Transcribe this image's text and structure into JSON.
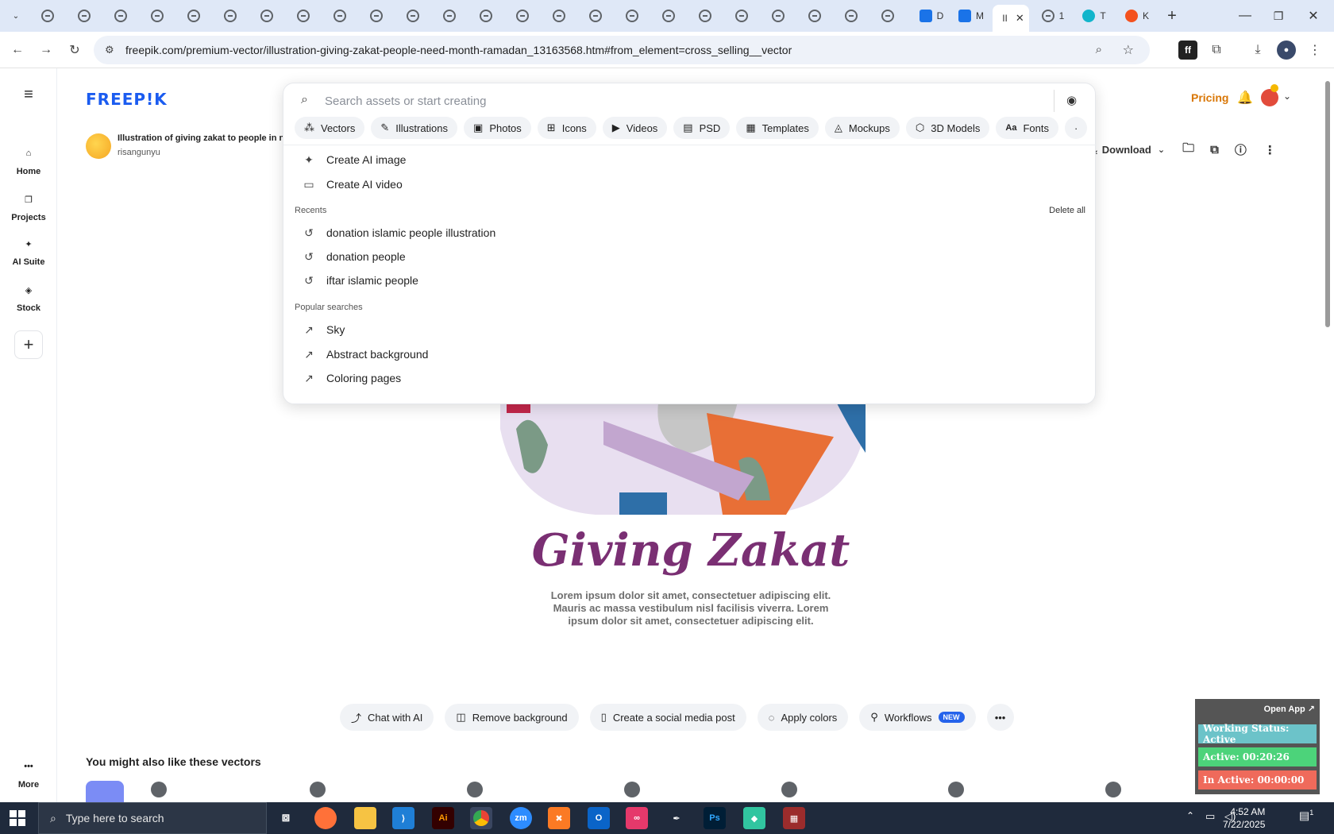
{
  "browser": {
    "tabs": [
      {
        "label": "D",
        "color": "#1a73e8"
      },
      {
        "label": "M",
        "color": "#1a73e8"
      },
      {
        "label": "II",
        "active": true
      },
      {
        "label": "1"
      },
      {
        "label": "T",
        "color": "#12b5cb"
      },
      {
        "label": "K",
        "color": "#f4511e"
      }
    ],
    "url": "freepik.com/premium-vector/illustration-giving-zakat-people-need-month-ramadan_13163568.htm#from_element=cross_selling__vector"
  },
  "rail": {
    "items": [
      {
        "label": "Home",
        "icon": "home-icon"
      },
      {
        "label": "Projects",
        "icon": "projects-icon"
      },
      {
        "label": "AI Suite",
        "icon": "sparkle-icon"
      },
      {
        "label": "Stock",
        "icon": "stock-icon"
      }
    ],
    "more": "More"
  },
  "header": {
    "logo": "FREEP!K",
    "pricing": "Pricing"
  },
  "asset": {
    "title": "Illustration of giving zakat to people in n",
    "author": "risangunyu",
    "download": "Download"
  },
  "search": {
    "placeholder": "Search assets or start creating",
    "chips": [
      "Vectors",
      "Illustrations",
      "Photos",
      "Icons",
      "Videos",
      "PSD",
      "Templates",
      "Mockups",
      "3D Models",
      "Fonts"
    ],
    "create": [
      "Create AI image",
      "Create AI video"
    ],
    "recents_title": "Recents",
    "delete_all": "Delete all",
    "recents": [
      "donation islamic  people illustration",
      "donation people",
      "iftar islamic people"
    ],
    "popular_title": "Popular searches",
    "popular": [
      "Sky",
      "Abstract background",
      "Coloring pages"
    ]
  },
  "artwork": {
    "title": "Giving Zakat",
    "body": "Lorem ipsum dolor sit amet, consectetuer adipiscing elit. Mauris ac massa vestibulum nisl facilisis viverra. Lorem ipsum dolor sit amet, consectetuer adipiscing elit."
  },
  "tools": [
    "Chat with AI",
    "Remove background",
    "Create a social media post",
    "Apply colors",
    "Workflows"
  ],
  "tools_badge": "NEW",
  "also_title": "You might also like these vectors",
  "widget": {
    "open": "Open App ↗",
    "status": "Working Status: Active",
    "active": "Active: 00:20:26",
    "inactive": "In Active: 00:00:00",
    "colors": {
      "status": "#6cc3c9",
      "active": "#4cd37a",
      "inactive": "#ef6a5b"
    }
  },
  "taskbar": {
    "search_placeholder": "Type here to search",
    "time": "4:52 AM",
    "date": "7/22/2025",
    "notif": "1"
  }
}
